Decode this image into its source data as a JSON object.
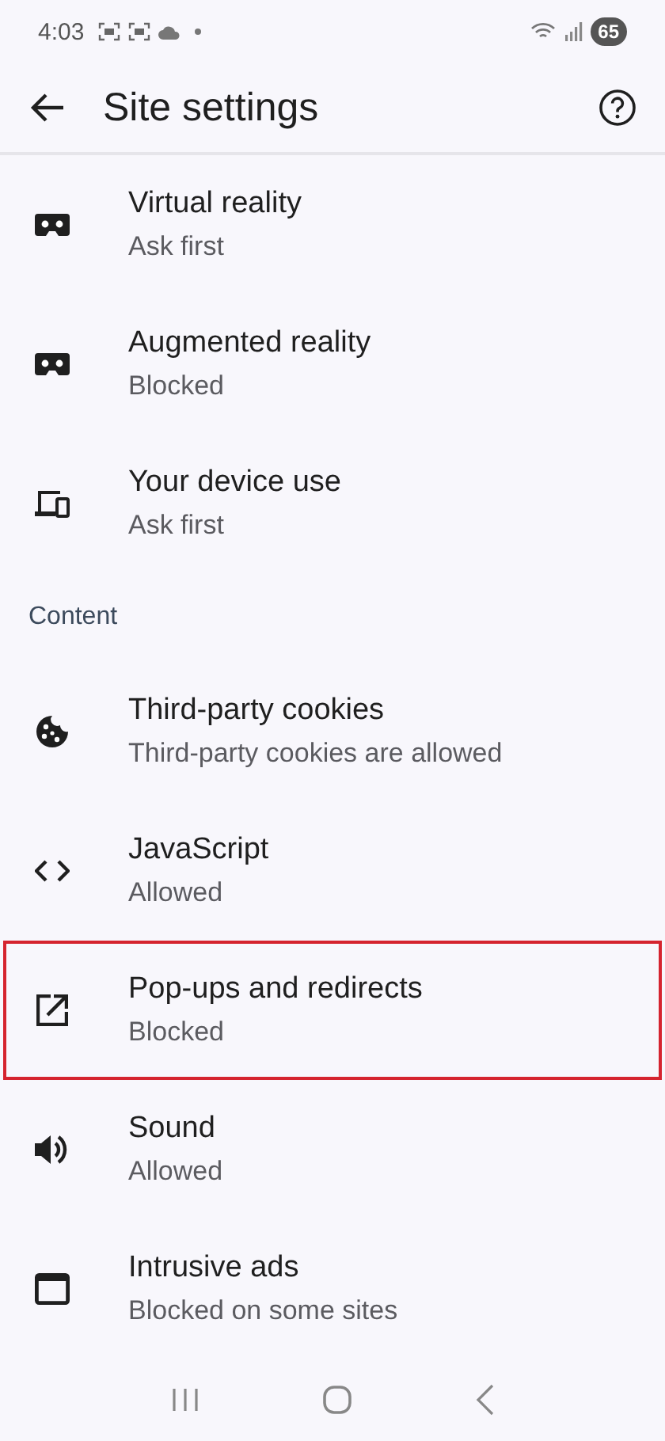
{
  "status_bar": {
    "time": "4:03",
    "battery": "65"
  },
  "toolbar": {
    "title": "Site settings"
  },
  "sections": [
    {
      "items": [
        {
          "title": "Virtual reality",
          "subtitle": "Ask first",
          "highlighted": false
        },
        {
          "title": "Augmented reality",
          "subtitle": "Blocked",
          "highlighted": false
        },
        {
          "title": "Your device use",
          "subtitle": "Ask first",
          "highlighted": false
        }
      ]
    },
    {
      "header": "Content",
      "items": [
        {
          "title": "Third-party cookies",
          "subtitle": "Third-party cookies are allowed",
          "highlighted": false
        },
        {
          "title": "JavaScript",
          "subtitle": "Allowed",
          "highlighted": false
        },
        {
          "title": "Pop-ups and redirects",
          "subtitle": "Blocked",
          "highlighted": true
        },
        {
          "title": "Sound",
          "subtitle": "Allowed",
          "highlighted": false
        },
        {
          "title": "Intrusive ads",
          "subtitle": "Blocked on some sites",
          "highlighted": false
        }
      ]
    }
  ]
}
